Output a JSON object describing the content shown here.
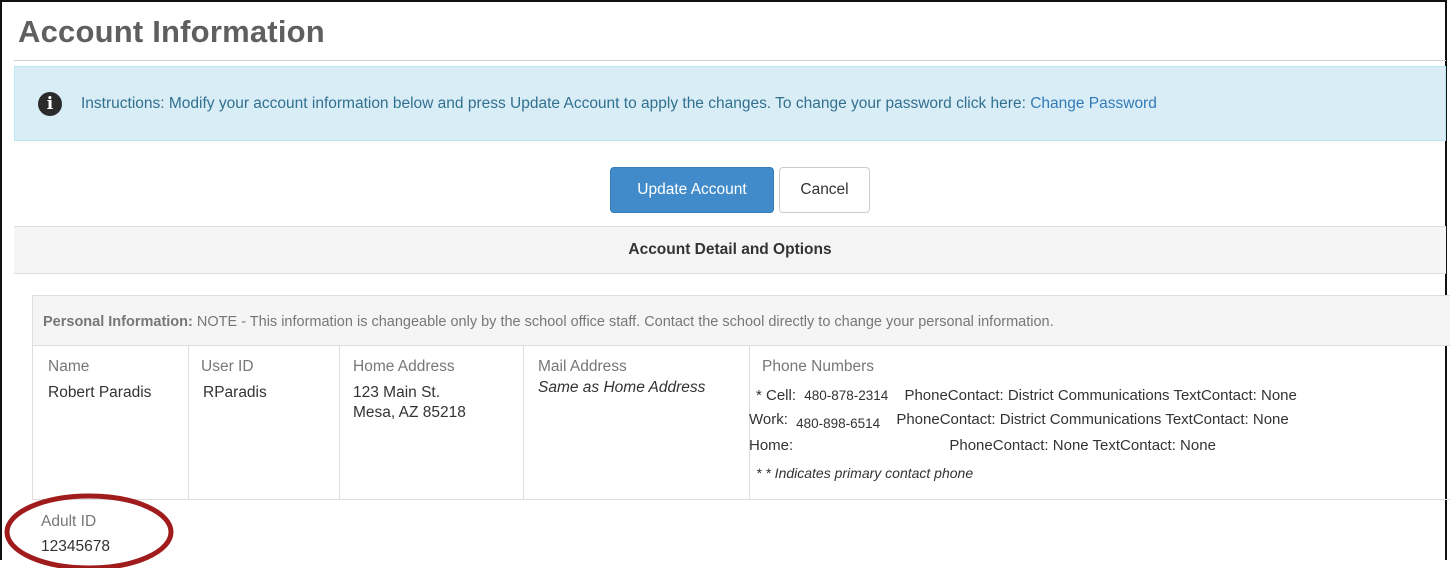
{
  "page": {
    "title": "Account Information"
  },
  "instructions": {
    "icon": "info-circle-icon",
    "text": "Instructions: Modify your account information below and press Update Account to apply the changes. To change your password click here: ",
    "link_label": "Change Password"
  },
  "actions": {
    "update_label": "Update Account",
    "cancel_label": "Cancel"
  },
  "section": {
    "title": "Account Detail and Options"
  },
  "personal": {
    "heading_bold": "Personal Information:",
    "heading_note": " NOTE - This information is changeable only by the school office staff. Contact the school directly to change your personal information.",
    "columns": {
      "name_label": "Name",
      "name_value": "Robert Paradis",
      "userid_label": "User ID",
      "userid_value": "RParadis",
      "home_label": "Home Address",
      "home_line1": "123 Main St.",
      "home_line2": "Mesa, AZ 85218",
      "mail_label": "Mail Address",
      "mail_value": "Same as Home Address",
      "phone_label": "Phone Numbers"
    },
    "phones": [
      {
        "type": "* Cell:",
        "number": "480-878-2314",
        "contact": "PhoneContact: District Communications TextContact: None"
      },
      {
        "type": "Work:",
        "number": "480-898-6514",
        "contact": "PhoneContact: District Communications TextContact: None"
      },
      {
        "type": "Home:",
        "number": "",
        "contact": "PhoneContact: None TextContact: None"
      }
    ],
    "primary_note": "* * Indicates primary contact phone"
  },
  "adult": {
    "label": "Adult ID",
    "value": "12345678"
  },
  "colors": {
    "info_bg": "#d9edf7",
    "info_text": "#31708f",
    "link": "#337ab7",
    "primary_button": "#428bca",
    "annotation_circle": "#a01c1c"
  }
}
